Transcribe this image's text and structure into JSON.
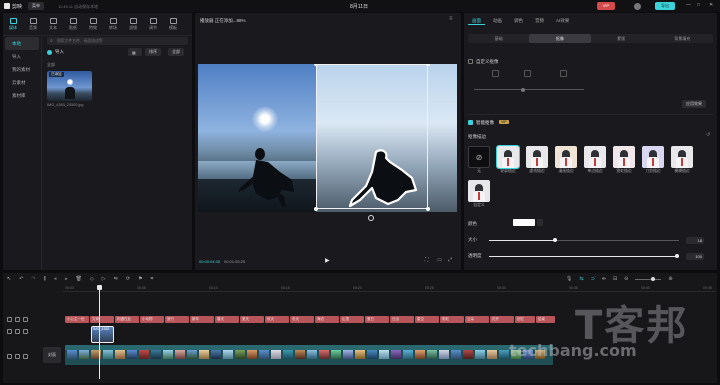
{
  "app": {
    "name": "剪映",
    "menu_label": "菜单",
    "autosave": "11:45:11 自动保存本地",
    "project_title": "8月11日",
    "vip_badge": "VIP",
    "export_label": "导出",
    "accent": "#3bd3d9"
  },
  "toolbar": {
    "items": [
      {
        "label": "媒体",
        "icon": "media-icon"
      },
      {
        "label": "音频",
        "icon": "audio-icon"
      },
      {
        "label": "文本",
        "icon": "text-icon"
      },
      {
        "label": "贴纸",
        "icon": "sticker-icon"
      },
      {
        "label": "特效",
        "icon": "effects-icon"
      },
      {
        "label": "转场",
        "icon": "transition-icon"
      },
      {
        "label": "滤镜",
        "icon": "filter-icon"
      },
      {
        "label": "调节",
        "icon": "adjust-icon"
      },
      {
        "label": "模板",
        "icon": "template-icon"
      }
    ]
  },
  "sidebar": {
    "items": [
      "本地",
      "导入",
      "我的素材",
      "云素材",
      "素材库"
    ]
  },
  "media": {
    "search_placeholder": "搜索文件名称、画面描述等",
    "import_label": "导入",
    "all_label": "全部",
    "sort_label": "排序",
    "filter_label": "全部",
    "section_label": "全部",
    "thumb_badge": "已添加",
    "thumb_name": "IMG_4383_20500.jpg"
  },
  "player": {
    "title": "播放器 正在添加...88%",
    "time_current": "00:00:04:35",
    "time_total": "00:01:05:25"
  },
  "inspector": {
    "tabs": [
      "画面",
      "动画",
      "调色",
      "音频",
      "AI效果"
    ],
    "subtabs": [
      "基础",
      "抠像",
      "蒙版",
      "背景填充"
    ],
    "custom_keying": "自定义抠像",
    "apply_label": "应用效果",
    "chroma_label": "智能抠像",
    "chroma_badge": "VIP",
    "stroke_label": "抠像描边",
    "presets": [
      "无",
      "轮廓描边",
      "虚线描边",
      "漫画描边",
      "单边描边",
      "霓虹描边",
      "刀剪描边",
      "模糊描边",
      "自定义"
    ],
    "color_label": "颜色",
    "size_label": "大小",
    "size_value": "18",
    "opacity_label": "透明度",
    "opacity_value": "100"
  },
  "timeline": {
    "ruler": [
      "00:00",
      "00:05",
      "00:10",
      "00:15",
      "00:20",
      "00:25",
      "00:30",
      "00:35",
      "00:40",
      "00:45",
      "00:50",
      "00:55"
    ],
    "cover_label": "封面",
    "overlay_clip": "IMG_4383",
    "text_clips": [
      "小公主一世",
      "文案",
      "相遇在此",
      "小动物",
      "旅行",
      "新年",
      "春天",
      "夏天",
      "秋天",
      "冬天",
      "海边",
      "山顶",
      "落日",
      "日出",
      "星空",
      "彩虹",
      "云朵",
      "花开",
      "回忆",
      "结束"
    ]
  },
  "watermark": {
    "brand": "T客邦",
    "url": "techbang.com"
  }
}
